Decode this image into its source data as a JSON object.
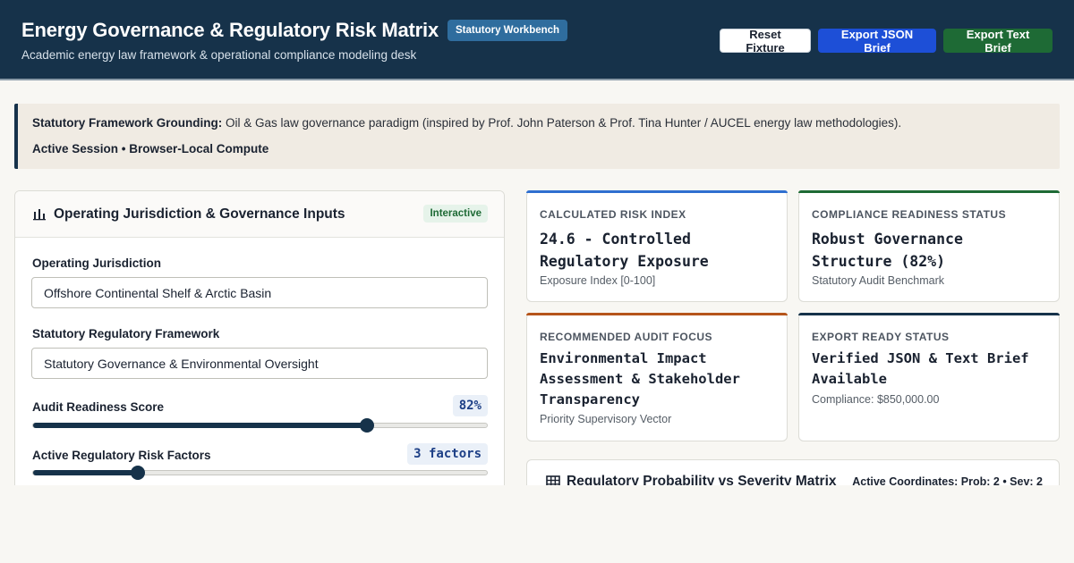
{
  "header": {
    "title": "Energy Governance & Regulatory Risk Matrix",
    "badge": "Statutory Workbench",
    "subtitle": "Academic energy law framework & operational compliance modeling desk",
    "buttons": {
      "reset": "Reset Fixture",
      "export_json": "Export JSON Brief",
      "export_text": "Export Text Brief"
    }
  },
  "banner": {
    "label": "Statutory Framework Grounding:",
    "text": "Oil & Gas law governance paradigm (inspired by Prof. John Paterson & Prof. Tina Hunter / AUCEL energy law methodologies).",
    "session": "Active Session • Browser-Local Compute"
  },
  "inputs_panel": {
    "title": "Operating Jurisdiction & Governance Inputs",
    "pill": "Interactive",
    "jurisdiction": {
      "label": "Operating Jurisdiction",
      "value": "Offshore Continental Shelf & Arctic Basin"
    },
    "framework": {
      "label": "Statutory Regulatory Framework",
      "value": "Statutory Governance & Environmental Oversight"
    },
    "audit_readiness": {
      "label": "Audit Readiness Score",
      "display": "82%",
      "level": 0.735
    },
    "risk_factors": {
      "label": "Active Regulatory Risk Factors",
      "display": "3 factors",
      "level": 0.23
    }
  },
  "cards": {
    "risk_index": {
      "label": "Calculated Risk Index",
      "value": "24.6 - Controlled Regulatory Exposure",
      "sub": "Exposure Index [0-100]",
      "accent": "#2f6fd0"
    },
    "compliance": {
      "label": "Compliance Readiness Status",
      "value": "Robust Governance Structure (82%)",
      "sub": "Statutory Audit Benchmark",
      "accent": "#1e6a35"
    },
    "audit_focus": {
      "label": "Recommended Audit Focus",
      "value": "Environmental Impact Assessment & Stakeholder Transparency",
      "sub": "Priority Supervisory Vector",
      "accent": "#b5541a"
    },
    "export": {
      "label": "Export Ready Status",
      "value": "Verified JSON & Text Brief Available",
      "sub": "Compliance: $850,000.00",
      "accent": "#16324a"
    }
  },
  "matrix_panel": {
    "title": "Regulatory Probability vs Severity Matrix",
    "coordinates": "Active Coordinates: Prob: 2 • Sev: 2"
  }
}
